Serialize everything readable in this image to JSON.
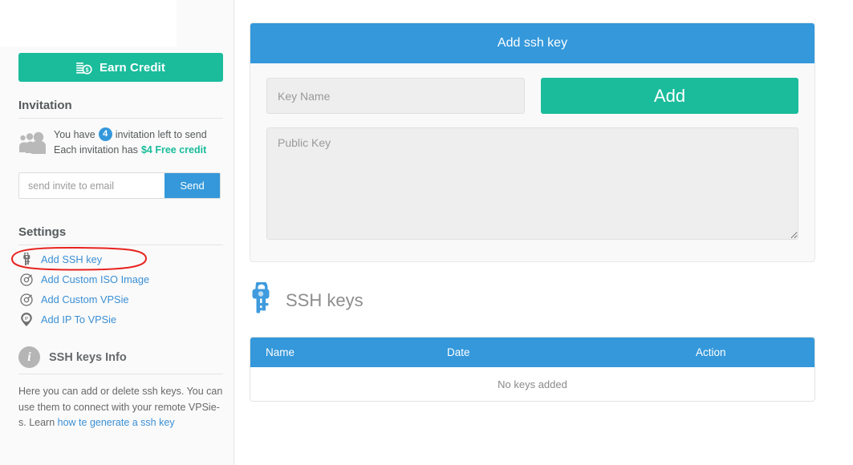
{
  "sidebar": {
    "earn_credit": {
      "label": "Earn Credit",
      "icon": "coins-icon",
      "color": "#1abc9c"
    },
    "invitation": {
      "title": "Invitation",
      "icon": "people-icon",
      "line1_prefix": "You have",
      "count": "4",
      "line1_suffix": "invitation left to send",
      "line2_prefix": "Each invitation has",
      "line2_credit": "$4 Free credit",
      "email_placeholder": "send invite to email",
      "email_value": "",
      "send_label": "Send"
    },
    "settings": {
      "title": "Settings",
      "items": [
        {
          "label": "Add SSH key",
          "icon": "keys-icon",
          "highlighted": true
        },
        {
          "label": "Add Custom ISO Image",
          "icon": "disc-icon",
          "highlighted": false
        },
        {
          "label": "Add Custom VPSie",
          "icon": "disc-icon",
          "highlighted": false
        },
        {
          "label": "Add IP To VPSie",
          "icon": "ip-pin-icon",
          "highlighted": false
        }
      ]
    },
    "info": {
      "title": "SSH keys Info",
      "icon": "info-icon",
      "body_text": "Here you can add or delete ssh keys. You can use them to connect with your remote VPSie-s. Learn ",
      "link_text": "how te generate a ssh key"
    }
  },
  "main": {
    "panel": {
      "title": "Add ssh key",
      "key_name_placeholder": "Key Name",
      "key_name_value": "",
      "add_label": "Add",
      "public_key_placeholder": "Public Key",
      "public_key_value": ""
    },
    "keys_section": {
      "title": "SSH keys",
      "icon": "ssh-keys-icon",
      "table": {
        "columns": [
          "Name",
          "Date",
          "Action"
        ],
        "rows": [],
        "empty_message": "No keys added"
      }
    }
  },
  "annotation": {
    "shape": "red-oval",
    "color": "#e8231f",
    "target": "Add SSH key"
  },
  "colors": {
    "primary_blue": "#3498db",
    "accent_green": "#1abc9c",
    "link_blue": "#3b8fd4",
    "sidebar_bg": "#fafafa",
    "field_gray": "#eeeeee"
  }
}
